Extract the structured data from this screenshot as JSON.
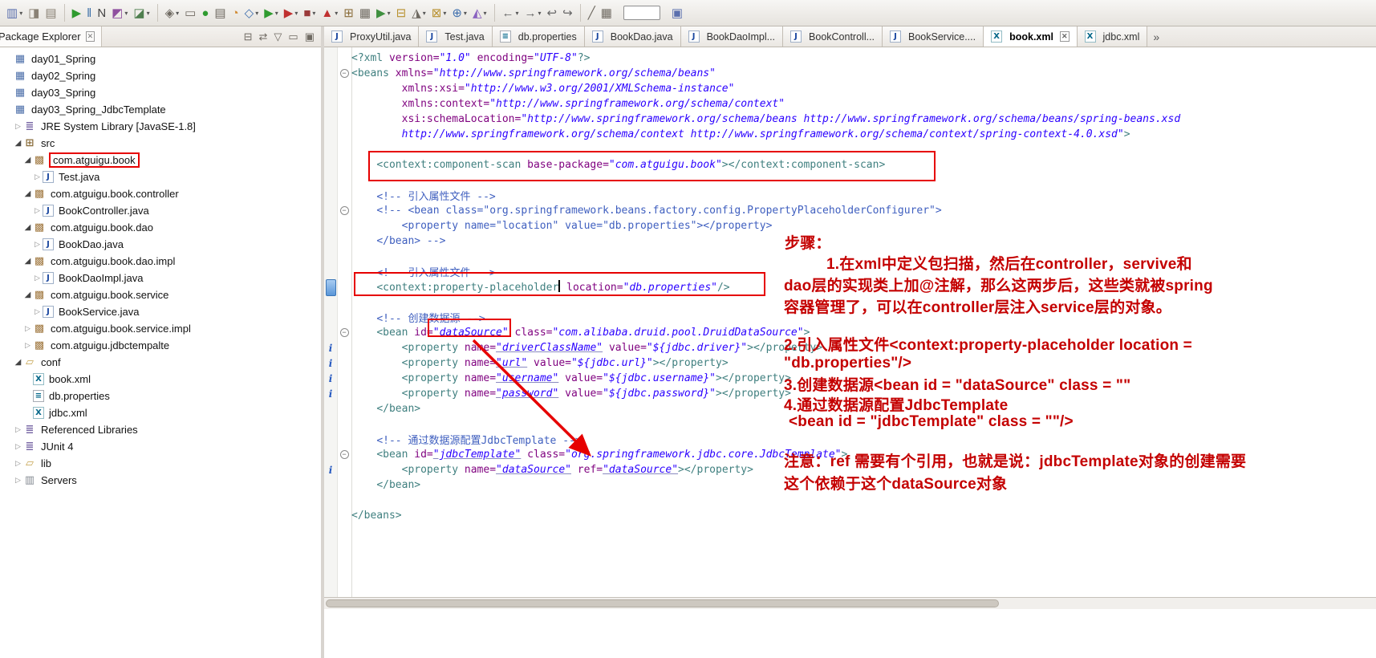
{
  "colors": {
    "accent_red": "#e60000",
    "note_red": "#c40000",
    "tag": "#3f7f7f",
    "attr_name": "#7f007f",
    "attr_value": "#2a00ff",
    "comment": "#3f5fbf",
    "selection_marker": "#5a96d8"
  },
  "toolbar": {
    "icons": [
      {
        "name": "new-wizard",
        "glyph": "▥",
        "color": "#5a6fae",
        "dd": true
      },
      {
        "name": "save",
        "glyph": "◨",
        "color": "#8a8276"
      },
      {
        "name": "print",
        "glyph": "▤",
        "color": "#8a8276"
      },
      {
        "sep": true
      },
      {
        "name": "run",
        "glyph": "▶",
        "color": "#2f9b2f"
      },
      {
        "name": "pause",
        "glyph": "‖",
        "color": "#3a6fa8"
      },
      {
        "name": "new-junit",
        "glyph": "N",
        "color": "#444444"
      },
      {
        "name": "coverage",
        "glyph": "◩",
        "color": "#8f4f9f",
        "dd": true
      },
      {
        "name": "profile",
        "glyph": "◪",
        "color": "#4f7f4f",
        "dd": true
      },
      {
        "sep": true
      },
      {
        "name": "external-tools",
        "glyph": "◈",
        "color": "#6f6a62",
        "dd": true
      },
      {
        "name": "open-task",
        "glyph": "▭",
        "color": "#6f6a62"
      },
      {
        "name": "record",
        "glyph": "●",
        "color": "#2f9b2f"
      },
      {
        "name": "task-list",
        "glyph": "▤",
        "color": "#6f6a62"
      },
      {
        "name": "history",
        "glyph": "◔",
        "color": "#d0882e"
      },
      {
        "name": "debug-snapshot",
        "glyph": "◇",
        "color": "#3f6fae",
        "dd": true
      },
      {
        "name": "debug",
        "glyph": "▶",
        "color": "#2f9b2f",
        "dd": true
      },
      {
        "name": "run-configurations",
        "glyph": "▶",
        "color": "#c03030",
        "dd": true
      },
      {
        "name": "stop",
        "glyph": "■",
        "color": "#9a3a3a",
        "dd": true
      },
      {
        "name": "flag",
        "glyph": "▲",
        "color": "#c03030",
        "dd": true
      },
      {
        "name": "new-package",
        "glyph": "⊞",
        "color": "#8a6d3b"
      },
      {
        "name": "schedule",
        "glyph": "▦",
        "color": "#6f6a62"
      },
      {
        "name": "start-server",
        "glyph": "▶",
        "color": "#3f8f3f",
        "dd": true
      },
      {
        "name": "database",
        "glyph": "⊟",
        "color": "#b8912f"
      },
      {
        "name": "annotate",
        "glyph": "◮",
        "color": "#6f6a62",
        "dd": true
      },
      {
        "name": "data-config",
        "glyph": "⊠",
        "color": "#b8912f",
        "dd": true
      },
      {
        "name": "web-browser",
        "glyph": "⊕",
        "color": "#3f6fae",
        "dd": true
      },
      {
        "name": "wizard-wand",
        "glyph": "◭",
        "color": "#8a62c0",
        "dd": true
      },
      {
        "sep": true
      },
      {
        "name": "back",
        "glyph": "←",
        "color": "#666666",
        "dd": true
      },
      {
        "name": "forward",
        "glyph": "→",
        "color": "#666666",
        "dd": true
      },
      {
        "name": "last-edit-location",
        "glyph": "↩",
        "color": "#666666"
      },
      {
        "name": "next-edit",
        "glyph": "↪",
        "color": "#666666"
      },
      {
        "sep": true
      },
      {
        "name": "mark-occurrences",
        "glyph": "╱",
        "color": "#6f6a62"
      },
      {
        "name": "table-grid",
        "glyph": "▦",
        "color": "#6f6a62"
      },
      {
        "name": "quick-access",
        "input": true
      },
      {
        "name": "java-perspective",
        "glyph": "▣",
        "color": "#5a6fae"
      }
    ]
  },
  "explorer": {
    "title": "Package Explorer",
    "close_glyph": "✕",
    "header_icons": [
      {
        "name": "collapse-all",
        "glyph": "⊟"
      },
      {
        "name": "link-with-editor",
        "glyph": "⇄"
      },
      {
        "name": "view-menu",
        "glyph": "▽"
      },
      {
        "name": "minimize",
        "glyph": "▭"
      },
      {
        "name": "maximize",
        "glyph": "▣"
      }
    ],
    "icon_glyphs": {
      "project": "▦",
      "library": "≣",
      "srcfolder": "⊞",
      "package": "▩",
      "java": "J",
      "xml": "X",
      "props": "≡",
      "folder": "▱",
      "server": "▥"
    },
    "tree": [
      {
        "label": "day01_Spring",
        "level": 0,
        "icon": "project"
      },
      {
        "label": "day02_Spring",
        "level": 0,
        "icon": "project"
      },
      {
        "label": "day03_Spring",
        "level": 0,
        "icon": "project"
      },
      {
        "label": "day03_Spring_JdbcTemplate",
        "level": 0,
        "icon": "project"
      },
      {
        "label": "JRE System Library [JavaSE-1.8]",
        "level": 1,
        "icon": "library",
        "arrow": "c"
      },
      {
        "label": "src",
        "level": 1,
        "icon": "srcfolder",
        "arrow": "e"
      },
      {
        "label": "com.atguigu.book",
        "level": 2,
        "icon": "package",
        "arrow": "e",
        "boxed": true
      },
      {
        "label": "Test.java",
        "level": 3,
        "icon": "java",
        "arrow": "c"
      },
      {
        "label": "com.atguigu.book.controller",
        "level": 2,
        "icon": "package",
        "arrow": "e"
      },
      {
        "label": "BookController.java",
        "level": 3,
        "icon": "java",
        "arrow": "c"
      },
      {
        "label": "com.atguigu.book.dao",
        "level": 2,
        "icon": "package",
        "arrow": "e"
      },
      {
        "label": "BookDao.java",
        "level": 3,
        "icon": "java",
        "arrow": "c"
      },
      {
        "label": "com.atguigu.book.dao.impl",
        "level": 2,
        "icon": "package",
        "arrow": "e"
      },
      {
        "label": "BookDaoImpl.java",
        "level": 3,
        "icon": "java",
        "arrow": "c"
      },
      {
        "label": "com.atguigu.book.service",
        "level": 2,
        "icon": "package",
        "arrow": "e"
      },
      {
        "label": "BookService.java",
        "level": 3,
        "icon": "java",
        "arrow": "c"
      },
      {
        "label": "com.atguigu.book.service.impl",
        "level": 2,
        "icon": "package",
        "arrow": "c"
      },
      {
        "label": "com.atguigu.jdbctempalte",
        "level": 2,
        "icon": "package",
        "arrow": "c"
      },
      {
        "label": "conf",
        "level": 1,
        "icon": "folder",
        "arrow": "e"
      },
      {
        "label": "book.xml",
        "level": 2,
        "icon": "xml"
      },
      {
        "label": "db.properties",
        "level": 2,
        "icon": "props"
      },
      {
        "label": "jdbc.xml",
        "level": 2,
        "icon": "xml"
      },
      {
        "label": "Referenced Libraries",
        "level": 1,
        "icon": "library",
        "arrow": "c"
      },
      {
        "label": "JUnit 4",
        "level": 1,
        "icon": "library",
        "arrow": "c"
      },
      {
        "label": "lib",
        "level": 1,
        "icon": "folder",
        "arrow": "c"
      },
      {
        "label": "Servers",
        "level": 1,
        "icon": "server",
        "arrow": "c"
      }
    ]
  },
  "tabs": [
    {
      "label": "ProxyUtil.java",
      "type": "java"
    },
    {
      "label": "Test.java",
      "type": "java"
    },
    {
      "label": "db.properties",
      "type": "props"
    },
    {
      "label": "BookDao.java",
      "type": "java"
    },
    {
      "label": "BookDaoImpl...",
      "type": "java"
    },
    {
      "label": "BookControll...",
      "type": "java"
    },
    {
      "label": "BookService....",
      "type": "java"
    },
    {
      "label": "book.xml",
      "type": "xml",
      "active": true,
      "close": true
    },
    {
      "label": "jdbc.xml",
      "type": "xml"
    }
  ],
  "editor": {
    "overflow_indicator": "»",
    "close_glyph": "✕",
    "lines": [
      {
        "seg": [
          [
            "<?xml ",
            "tag"
          ],
          [
            "version=",
            "attr"
          ],
          [
            "\"1.0\"",
            "val"
          ],
          [
            " ",
            "plain"
          ],
          [
            "encoding=",
            "attr"
          ],
          [
            "\"UTF-8\"",
            "val"
          ],
          [
            "?>",
            "tag"
          ]
        ]
      },
      {
        "f": true,
        "seg": [
          [
            "<beans ",
            "tag"
          ],
          [
            "xmlns=",
            "attr"
          ],
          [
            "\"http://www.springframework.org/schema/beans\"",
            "val"
          ]
        ]
      },
      {
        "seg": [
          [
            "        ",
            "plain"
          ],
          [
            "xmlns:xsi=",
            "attr"
          ],
          [
            "\"http://www.w3.org/2001/XMLSchema-instance\"",
            "val"
          ]
        ]
      },
      {
        "seg": [
          [
            "        ",
            "plain"
          ],
          [
            "xmlns:context=",
            "attr"
          ],
          [
            "\"http://www.springframework.org/schema/context\"",
            "val"
          ]
        ]
      },
      {
        "seg": [
          [
            "        ",
            "plain"
          ],
          [
            "xsi:schemaLocation=",
            "attr"
          ],
          [
            "\"http://www.springframework.org/schema/beans http://www.springframework.org/schema/beans/spring-beans.xsd",
            "val"
          ]
        ]
      },
      {
        "seg": [
          [
            "        ",
            "plain"
          ],
          [
            "http://www.springframework.org/schema/context http://www.springframework.org/schema/context/spring-context-4.0.xsd\"",
            "val"
          ],
          [
            ">",
            "tag"
          ]
        ]
      },
      {
        "seg": []
      },
      {
        "seg": [
          [
            "    ",
            "plain"
          ],
          [
            "<context:component-scan ",
            "tag"
          ],
          [
            "base-package=",
            "attr"
          ],
          [
            "\"com.atguigu.book\"",
            "val"
          ],
          [
            "></context:component-scan>",
            "tag"
          ]
        ]
      },
      {
        "seg": []
      },
      {
        "seg": [
          [
            "    ",
            "plain"
          ],
          [
            "<!-- 引入属性文件 -->",
            "cmt"
          ]
        ]
      },
      {
        "f": true,
        "seg": [
          [
            "    ",
            "plain"
          ],
          [
            "<!-- <bean class=\"org.springframework.beans.factory.config.PropertyPlaceholderConfigurer\">",
            "cmt"
          ]
        ]
      },
      {
        "seg": [
          [
            "        ",
            "plain"
          ],
          [
            "<property name=\"location\" value=\"db.properties\"></property>",
            "cmt"
          ]
        ]
      },
      {
        "seg": [
          [
            "    ",
            "plain"
          ],
          [
            "</bean> -->",
            "cmt"
          ]
        ]
      },
      {
        "seg": []
      },
      {
        "seg": [
          [
            "    ",
            "plain"
          ],
          [
            "<!-- 引入属性文件 -->",
            "cmt"
          ]
        ]
      },
      {
        "sel": true,
        "seg": [
          [
            "    ",
            "plain"
          ],
          [
            "<context:property-placeholder",
            "tag"
          ],
          [
            "",
            "caret"
          ],
          [
            " ",
            "plain"
          ],
          [
            "location=",
            "attr"
          ],
          [
            "\"db.properties\"",
            "val"
          ],
          [
            "/>",
            "tag"
          ]
        ]
      },
      {
        "seg": []
      },
      {
        "seg": [
          [
            "    ",
            "plain"
          ],
          [
            "<!-- 创建数据源 -->",
            "cmt"
          ]
        ]
      },
      {
        "f": true,
        "seg": [
          [
            "    ",
            "plain"
          ],
          [
            "<bean ",
            "tag"
          ],
          [
            "id=",
            "attr"
          ],
          [
            "\"dataSource\"",
            "valu"
          ],
          [
            " ",
            "plain"
          ],
          [
            "class=",
            "attr"
          ],
          [
            "\"com.alibaba.druid.pool.DruidDataSource\"",
            "val"
          ],
          [
            ">",
            "tag"
          ]
        ]
      },
      {
        "m": "i",
        "seg": [
          [
            "        ",
            "plain"
          ],
          [
            "<property ",
            "tag"
          ],
          [
            "name=",
            "attr"
          ],
          [
            "\"driverClassName\"",
            "valu"
          ],
          [
            " ",
            "plain"
          ],
          [
            "value=",
            "attr"
          ],
          [
            "\"${jdbc.driver}\"",
            "val"
          ],
          [
            "></property>",
            "tag"
          ]
        ]
      },
      {
        "m": "i",
        "seg": [
          [
            "        ",
            "plain"
          ],
          [
            "<property ",
            "tag"
          ],
          [
            "name=",
            "attr"
          ],
          [
            "\"url\"",
            "valu"
          ],
          [
            " ",
            "plain"
          ],
          [
            "value=",
            "attr"
          ],
          [
            "\"${jdbc.url}\"",
            "val"
          ],
          [
            "></property>",
            "tag"
          ]
        ]
      },
      {
        "m": "i",
        "seg": [
          [
            "        ",
            "plain"
          ],
          [
            "<property ",
            "tag"
          ],
          [
            "name=",
            "attr"
          ],
          [
            "\"username\"",
            "valu"
          ],
          [
            " ",
            "plain"
          ],
          [
            "value=",
            "attr"
          ],
          [
            "\"${jdbc.username}\"",
            "val"
          ],
          [
            "></property>",
            "tag"
          ]
        ]
      },
      {
        "m": "i",
        "seg": [
          [
            "        ",
            "plain"
          ],
          [
            "<property ",
            "tag"
          ],
          [
            "name=",
            "attr"
          ],
          [
            "\"password\"",
            "valu"
          ],
          [
            " ",
            "plain"
          ],
          [
            "value=",
            "attr"
          ],
          [
            "\"${jdbc.password}\"",
            "val"
          ],
          [
            "></property>",
            "tag"
          ]
        ]
      },
      {
        "seg": [
          [
            "    ",
            "plain"
          ],
          [
            "</bean>",
            "tag"
          ]
        ]
      },
      {
        "seg": []
      },
      {
        "seg": [
          [
            "    ",
            "plain"
          ],
          [
            "<!-- 通过数据源配置JdbcTemplate -->",
            "cmt"
          ]
        ]
      },
      {
        "f": true,
        "seg": [
          [
            "    ",
            "plain"
          ],
          [
            "<bean ",
            "tag"
          ],
          [
            "id=",
            "attr"
          ],
          [
            "\"jdbcTemplate\"",
            "valu"
          ],
          [
            " ",
            "plain"
          ],
          [
            "class=",
            "attr"
          ],
          [
            "\"org.springframework.jdbc.core.JdbcTemplate\"",
            "val"
          ],
          [
            ">",
            "tag"
          ]
        ]
      },
      {
        "m": "i",
        "seg": [
          [
            "        ",
            "plain"
          ],
          [
            "<property ",
            "tag"
          ],
          [
            "name=",
            "attr"
          ],
          [
            "\"dataSource\"",
            "valu"
          ],
          [
            " ",
            "plain"
          ],
          [
            "ref=",
            "attr"
          ],
          [
            "\"dataSource\"",
            "valu"
          ],
          [
            "></property>",
            "tag"
          ]
        ]
      },
      {
        "seg": [
          [
            "    ",
            "plain"
          ],
          [
            "</bean>",
            "tag"
          ]
        ]
      },
      {
        "seg": []
      },
      {
        "seg": [
          [
            "</beans>",
            "tag"
          ]
        ]
      }
    ]
  },
  "annotations": {
    "notes": [
      "步骤：",
      "1.在xml中定义包扫描，然后在controller，servive和",
      "dao层的实现类上加@注解，那么这两步后，这些类就被spring",
      "容器管理了，可以在controller层注入service层的对象。",
      "2.引入属性文件<context:property-placeholder  location =",
      "\"db.properties\"/>",
      "3.创建数据源<bean id = \"dataSource\" class = \"\"",
      "4.通过数据源配置JdbcTemplate",
      "<bean id = \"jdbcTemplate\" class = \"\"/>",
      "注意：ref 需要有个引用，也就是说：jdbcTemplate对象的创建需要",
      "这个依赖于这个dataSource对象"
    ]
  }
}
